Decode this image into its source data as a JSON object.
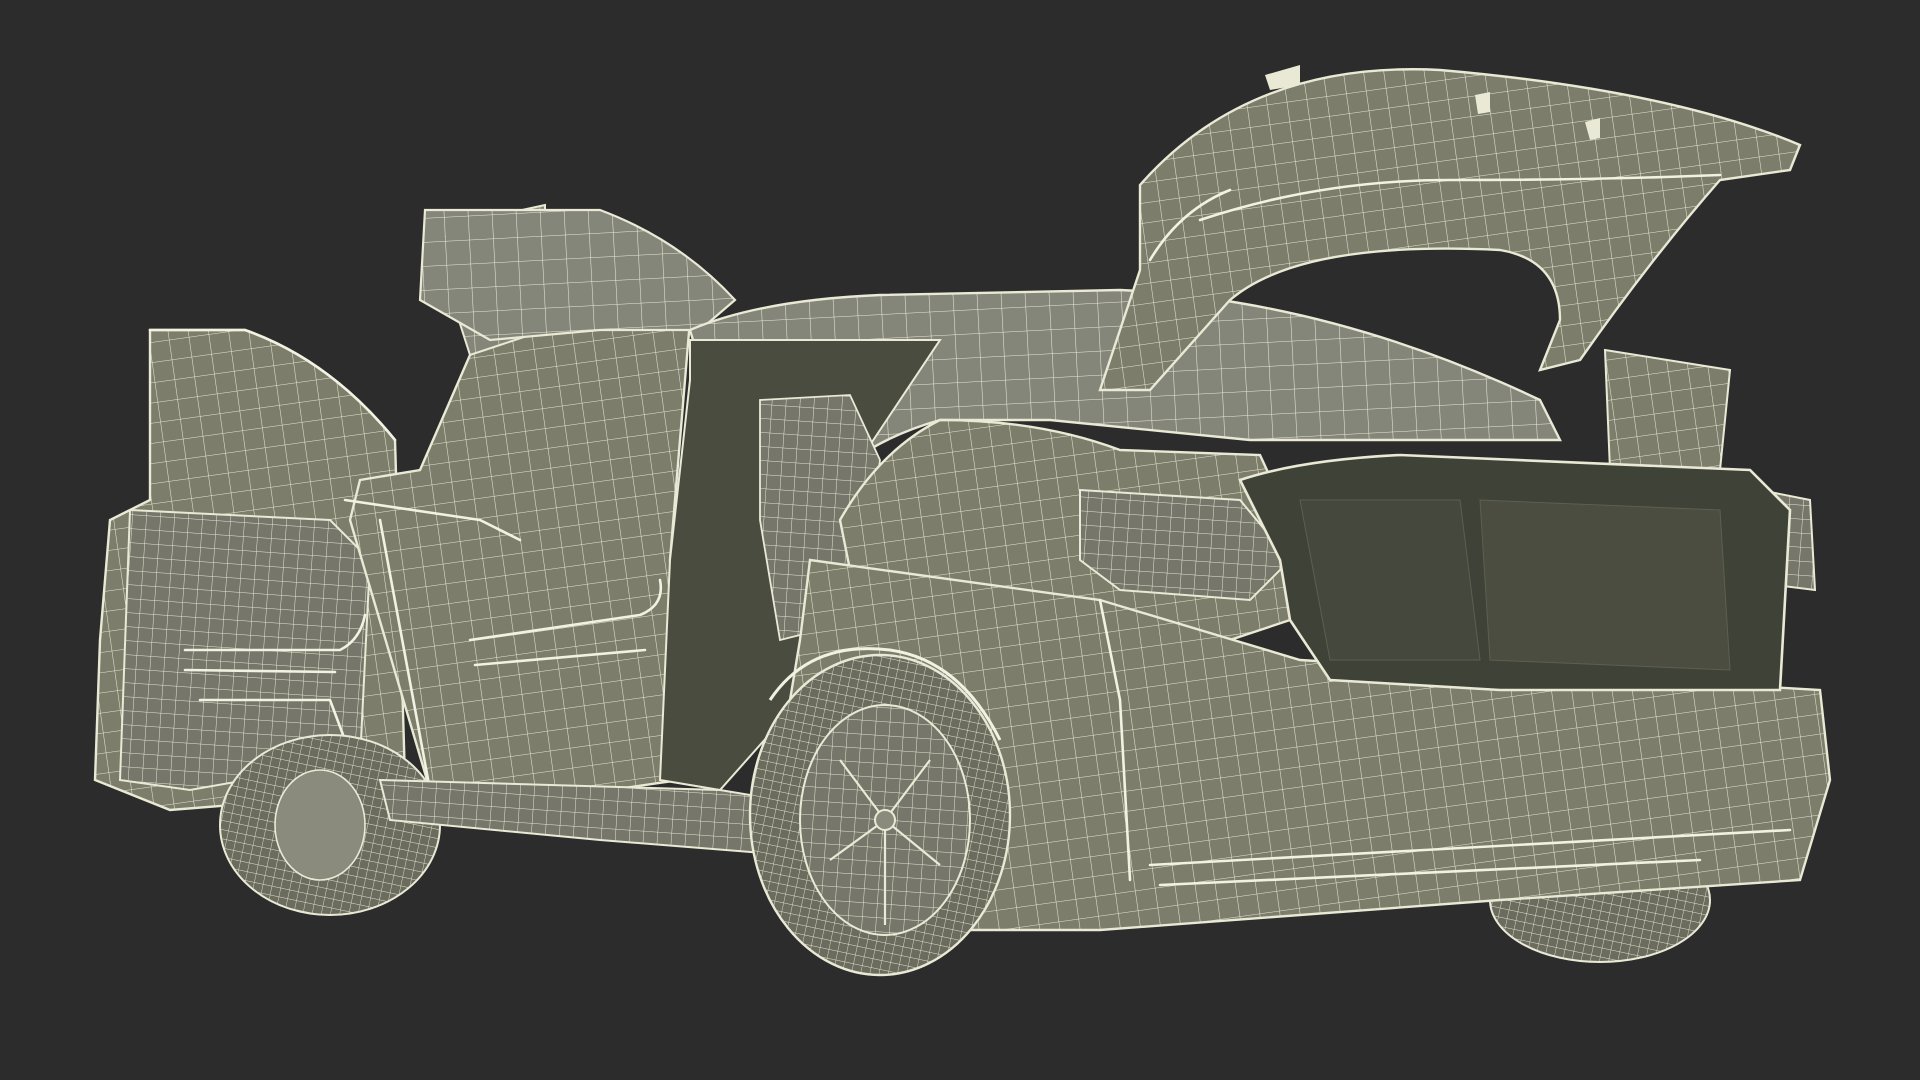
{
  "scene": {
    "background_color": "#2c2c2c",
    "mesh_fill_color": "#7c7d6b",
    "wire_color": "#e9e9d6"
  }
}
